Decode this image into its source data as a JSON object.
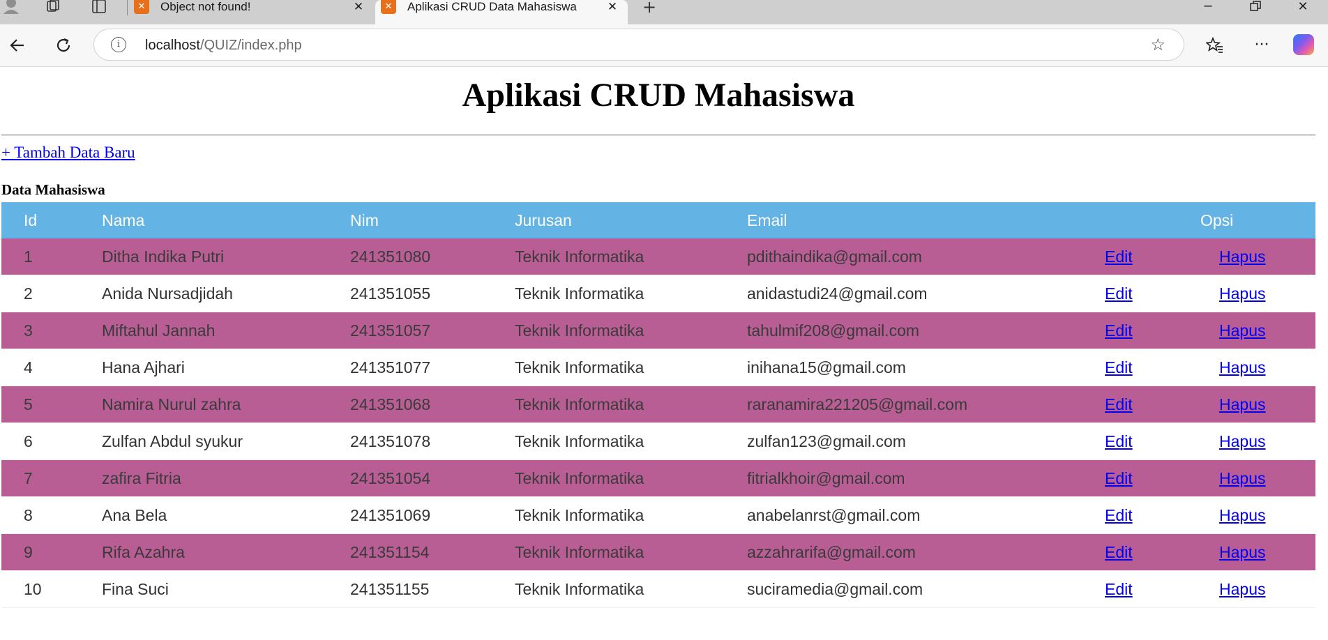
{
  "browser": {
    "tabs": [
      {
        "title": "Object not found!",
        "active": false
      },
      {
        "title": "Aplikasi CRUD Data Mahasiswa",
        "active": true
      }
    ],
    "address": {
      "host": "localhost",
      "path": "/QUIZ/index.php"
    },
    "icons": {
      "profile": "profile-icon",
      "workspaces": "workspaces-icon",
      "tab_actions": "tab-actions-icon",
      "new_tab": "plus-icon",
      "back": "back-arrow-icon",
      "refresh": "refresh-icon",
      "info": "info-icon",
      "favorite": "star-icon",
      "favorites": "favorites-icon",
      "menu": "more-icon",
      "copilot": "copilot-icon"
    }
  },
  "page": {
    "title": "Aplikasi CRUD Mahasiswa",
    "add_link": "+ Tambah Data Baru",
    "section_title": "Data Mahasiswa",
    "colors": {
      "header_bg": "#63b3e5",
      "odd_row_bg": "#b85e95",
      "link": "#0000ee"
    },
    "table": {
      "headers": {
        "id": "Id",
        "nama": "Nama",
        "nim": "Nim",
        "jurusan": "Jurusan",
        "email": "Email",
        "opsi": "Opsi"
      },
      "edit_label": "Edit",
      "hapus_label": "Hapus",
      "rows": [
        {
          "id": "1",
          "nama": "Ditha Indika Putri",
          "nim": "241351080",
          "jurusan": "Teknik Informatika",
          "email": "pdithaindika@gmail.com"
        },
        {
          "id": "2",
          "nama": "Anida Nursadjidah",
          "nim": "241351055",
          "jurusan": "Teknik Informatika",
          "email": "anidastudi24@gmail.com"
        },
        {
          "id": "3",
          "nama": "Miftahul Jannah",
          "nim": "241351057",
          "jurusan": "Teknik Informatika",
          "email": "tahulmif208@gmail.com"
        },
        {
          "id": "4",
          "nama": "Hana Ajhari",
          "nim": "241351077",
          "jurusan": "Teknik Informatika",
          "email": "inihana15@gmail.com"
        },
        {
          "id": "5",
          "nama": "Namira Nurul zahra",
          "nim": "241351068",
          "jurusan": "Teknik Informatika",
          "email": "raranamira221205@gmail.com"
        },
        {
          "id": "6",
          "nama": "Zulfan Abdul syukur",
          "nim": "241351078",
          "jurusan": "Teknik Informatika",
          "email": "zulfan123@gmail.com"
        },
        {
          "id": "7",
          "nama": "zafira Fitria",
          "nim": "241351054",
          "jurusan": "Teknik Informatika",
          "email": "fitrialkhoir@gmail.com"
        },
        {
          "id": "8",
          "nama": "Ana Bela",
          "nim": "241351069",
          "jurusan": "Teknik Informatika",
          "email": "anabelanrst@gmail.com"
        },
        {
          "id": "9",
          "nama": "Rifa Azahra",
          "nim": "241351154",
          "jurusan": "Teknik Informatika",
          "email": "azzahrarifa@gmail.com"
        },
        {
          "id": "10",
          "nama": "Fina Suci",
          "nim": "241351155",
          "jurusan": "Teknik Informatika",
          "email": "suciramedia@gmail.com"
        }
      ]
    }
  }
}
